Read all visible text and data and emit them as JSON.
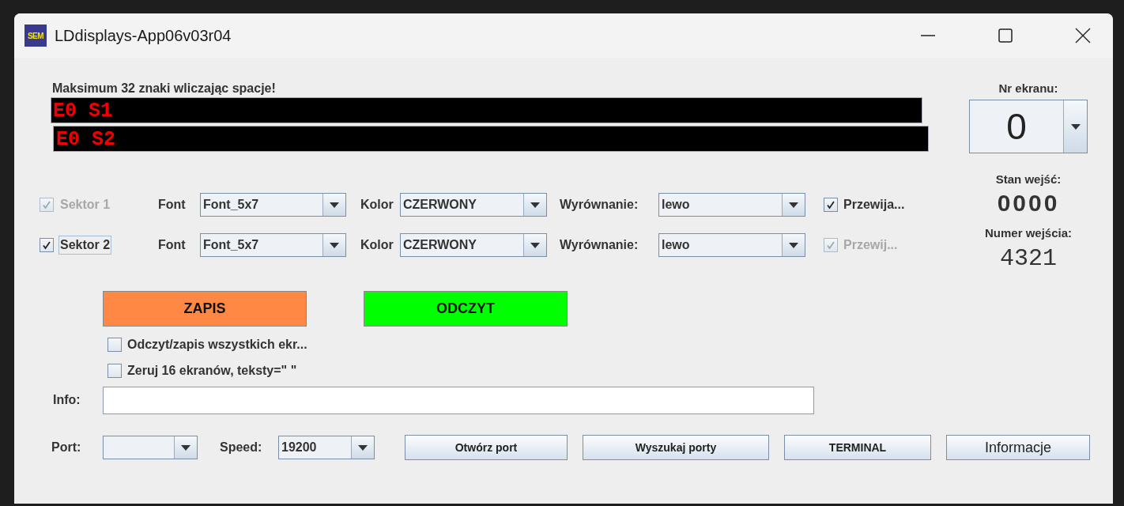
{
  "window": {
    "title": "LDdisplays-App06v03r04",
    "logo_text": "SEM"
  },
  "hint": "Maksimum 32 znaki wliczając spacje!",
  "display_lines": [
    {
      "text": "E0 S1"
    },
    {
      "text": "E0 S2"
    }
  ],
  "sectors": [
    {
      "label": "Sektor 1",
      "enabled": false,
      "checked": true,
      "focused": false,
      "font_label": "Font",
      "font": "Font_5x7",
      "color_label": "Kolor",
      "color_name": "CZERWONY",
      "align_label": "Wyrównanie:",
      "align": "lewo",
      "scroll": {
        "label": "Przewija...",
        "enabled": true,
        "checked": true
      }
    },
    {
      "label": "Sektor 2",
      "enabled": true,
      "checked": true,
      "focused": true,
      "font_label": "Font",
      "font": "Font_5x7",
      "color_label": "Kolor",
      "color_name": "CZERWONY",
      "align_label": "Wyrównanie:",
      "align": "lewo",
      "scroll": {
        "label": "Przewij...",
        "enabled": false,
        "checked": true
      }
    }
  ],
  "actions": [
    {
      "label": "ZAPIS",
      "color": "#ff8845"
    },
    {
      "label": "ODCZYT",
      "color": "#00ff00"
    }
  ],
  "options": [
    {
      "label": "Odczyt/zapis wszystkich ekr...",
      "checked": false
    },
    {
      "label": "Zeruj 16 ekranów, teksty=\" \"",
      "checked": false
    }
  ],
  "info": {
    "label": "Info:"
  },
  "port": {
    "label": "Port:"
  },
  "speed": {
    "label": "Speed:",
    "value": "19200"
  },
  "buttons": [
    {
      "label": "Otwórz port",
      "kind": "compact"
    },
    {
      "label": "Wyszukaj porty",
      "kind": "compact"
    },
    {
      "label": "TERMINAL",
      "kind": "compact"
    },
    {
      "label": "Informacje",
      "kind": "plain"
    }
  ],
  "screen": {
    "label": "Nr ekranu:",
    "value": "0"
  },
  "inputs_state": {
    "label": "Stan wejść:",
    "value": "0000"
  },
  "input_number": {
    "label": "Numer wejścia:",
    "value": "4321"
  }
}
